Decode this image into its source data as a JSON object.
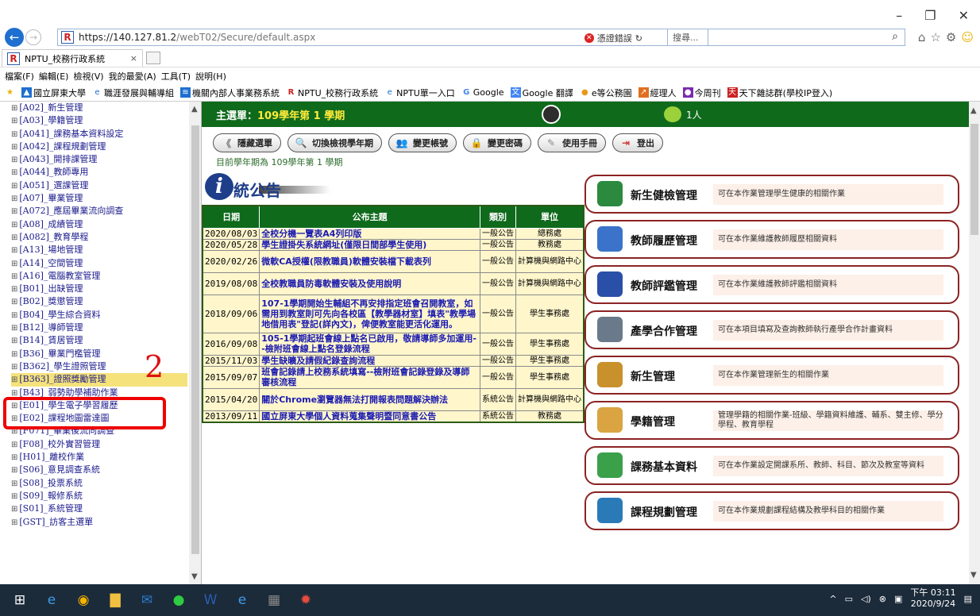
{
  "browser": {
    "url_host": "https://140.127.81.2",
    "url_path": "/webT02/Secure/default.aspx",
    "cert_error": "憑證錯誤",
    "search_placeholder": "搜尋...",
    "tab_title": "NPTU_校務行政系統"
  },
  "menubar": [
    "檔案(F)",
    "編輯(E)",
    "檢視(V)",
    "我的最愛(A)",
    "工具(T)",
    "說明(H)"
  ],
  "favorites": [
    "國立屏東大學",
    "職涯發展與輔導組",
    "機關內部人事業務系統",
    "NPTU_校務行政系統",
    "NPTU單一入口",
    "Google",
    "Google 翻譯",
    "e等公務園",
    "經理人",
    "今周刊",
    "天下雜誌群(學校IP登入)"
  ],
  "sidebar": {
    "items": [
      "[A02]_新生管理",
      "[A03]_學籍管理",
      "[A041]_課務基本資料設定",
      "[A042]_課程規劃管理",
      "[A043]_開排課管理",
      "[A044]_教師專用",
      "[A051]_選課管理",
      "[A07]_畢業管理",
      "[A072]_應屆畢業流向調查",
      "[A08]_成績管理",
      "[A082]_教育學程",
      "[A13]_場地管理",
      "[A14]_空間管理",
      "[A16]_電腦教室管理",
      "[B01]_出缺管理",
      "[B02]_獎懲管理",
      "[B04]_學生綜合資料",
      "[B12]_導師管理",
      "[B14]_賃居管理",
      "[B36]_畢業門檻管理",
      "[B362]_學生證照管理",
      "[B363]_證照獎勵管理",
      "[B43]_弱勢助學補助作業",
      "[E01]_學生電子學習履歷",
      "[E02]_課程地圖雷達圖",
      "[F071]_畢業後流向調查",
      "[F08]_校外實習管理",
      "[H01]_離校作業",
      "[S06]_意見調查系統",
      "[S08]_投票系統",
      "[S09]_報修系統",
      "[S01]_系統管理",
      "[GST]_訪客主選單"
    ],
    "selected_index": 21
  },
  "annotation": {
    "number": "2"
  },
  "header": {
    "label": "主選單：",
    "term": "109學年第 1 學期",
    "online_count": "1人"
  },
  "buttons": [
    "隱藏選單",
    "切換檢視學年期",
    "變更帳號",
    "變更密碼",
    "使用手冊",
    "登出"
  ],
  "current_term": "目前學年期為 109學年第 1 學期",
  "announce_title": "統公告",
  "announce_icon": "i",
  "table": {
    "headers": [
      "日期",
      "公布主題",
      "類別",
      "單位"
    ],
    "rows": [
      {
        "date": "2020/08/03",
        "subject": "全校分機一覽表A4列印版",
        "cat": "一般公告",
        "unit": "總務處"
      },
      {
        "date": "2020/05/28",
        "subject": "學生證掛失系統網址(僅限日間部學生使用)",
        "cat": "一般公告",
        "unit": "教務處"
      },
      {
        "date": "2020/02/26",
        "subject": "微軟CA授權(限教職員)軟體安裝檔下載表列",
        "cat": "一般公告",
        "unit": "計算機與網路中心"
      },
      {
        "date": "2019/08/08",
        "subject": "全校教職員防毒軟體安裝及使用說明",
        "cat": "一般公告",
        "unit": "計算機與網路中心"
      },
      {
        "date": "2018/09/06",
        "subject": "107-1學期開始生輔組不再安排指定班會召開教室，如需用到教室則可先向各校區【教學器材室】填表\"教學場地借用表\"登記(詳內文)，俾便教室能更活化運用。",
        "cat": "一般公告",
        "unit": "學生事務處"
      },
      {
        "date": "2016/09/08",
        "subject": "105-1學期起班會線上點名已啟用，敬請導師多加運用--檢附班會線上點名登錄流程",
        "cat": "一般公告",
        "unit": "學生事務處"
      },
      {
        "date": "2015/11/03",
        "subject": "學生缺曠及請假紀錄查詢流程",
        "cat": "一般公告",
        "unit": "學生事務處"
      },
      {
        "date": "2015/09/07",
        "subject": "班會記錄請上校務系統填寫--檢附班會記錄登錄及導師審核流程",
        "cat": "一般公告",
        "unit": "學生事務處"
      },
      {
        "date": "2015/04/20",
        "subject": "關於Chrome瀏覽器無法打開報表問題解決辦法",
        "cat": "系統公告",
        "unit": "計算機與網路中心"
      },
      {
        "date": "2013/09/11",
        "subject": "國立屏東大學個人資料蒐集聲明暨同意書公告",
        "cat": "系統公告",
        "unit": "教務處"
      }
    ]
  },
  "cards": [
    {
      "name": "新生健檢管理",
      "desc": "可在本作業管理學生健康的相關作業",
      "color": "#2b8a3e"
    },
    {
      "name": "教師履歷管理",
      "desc": "可在本作業維護教師履歷相關資料",
      "color": "#3a73c9"
    },
    {
      "name": "教師評鑑管理",
      "desc": "可在本作業維護教師評鑑相關資料",
      "color": "#2a4fa8"
    },
    {
      "name": "產學合作管理",
      "desc": "可在本項目填寫及查詢教師執行產學合作計畫資料",
      "color": "#6a7a8a"
    },
    {
      "name": "新生管理",
      "desc": "可在本作業管理新生的相關作業",
      "color": "#c9912b"
    },
    {
      "name": "學籍管理",
      "desc": "管理學籍的相關作業-班級、學籍資料維護、輔系、雙主修、學分學程、教育學程",
      "color": "#d9a441"
    },
    {
      "name": "課務基本資料",
      "desc": "可在本作業設定開課系所、教師、科目、節次及教室等資料",
      "color": "#3aa04a"
    },
    {
      "name": "課程規劃管理",
      "desc": "可在本作業規劃課程結構及教學科目的相關作業",
      "color": "#2a7ab8"
    }
  ],
  "taskbar": {
    "time": "下午 03:11",
    "date": "2020/9/24"
  }
}
